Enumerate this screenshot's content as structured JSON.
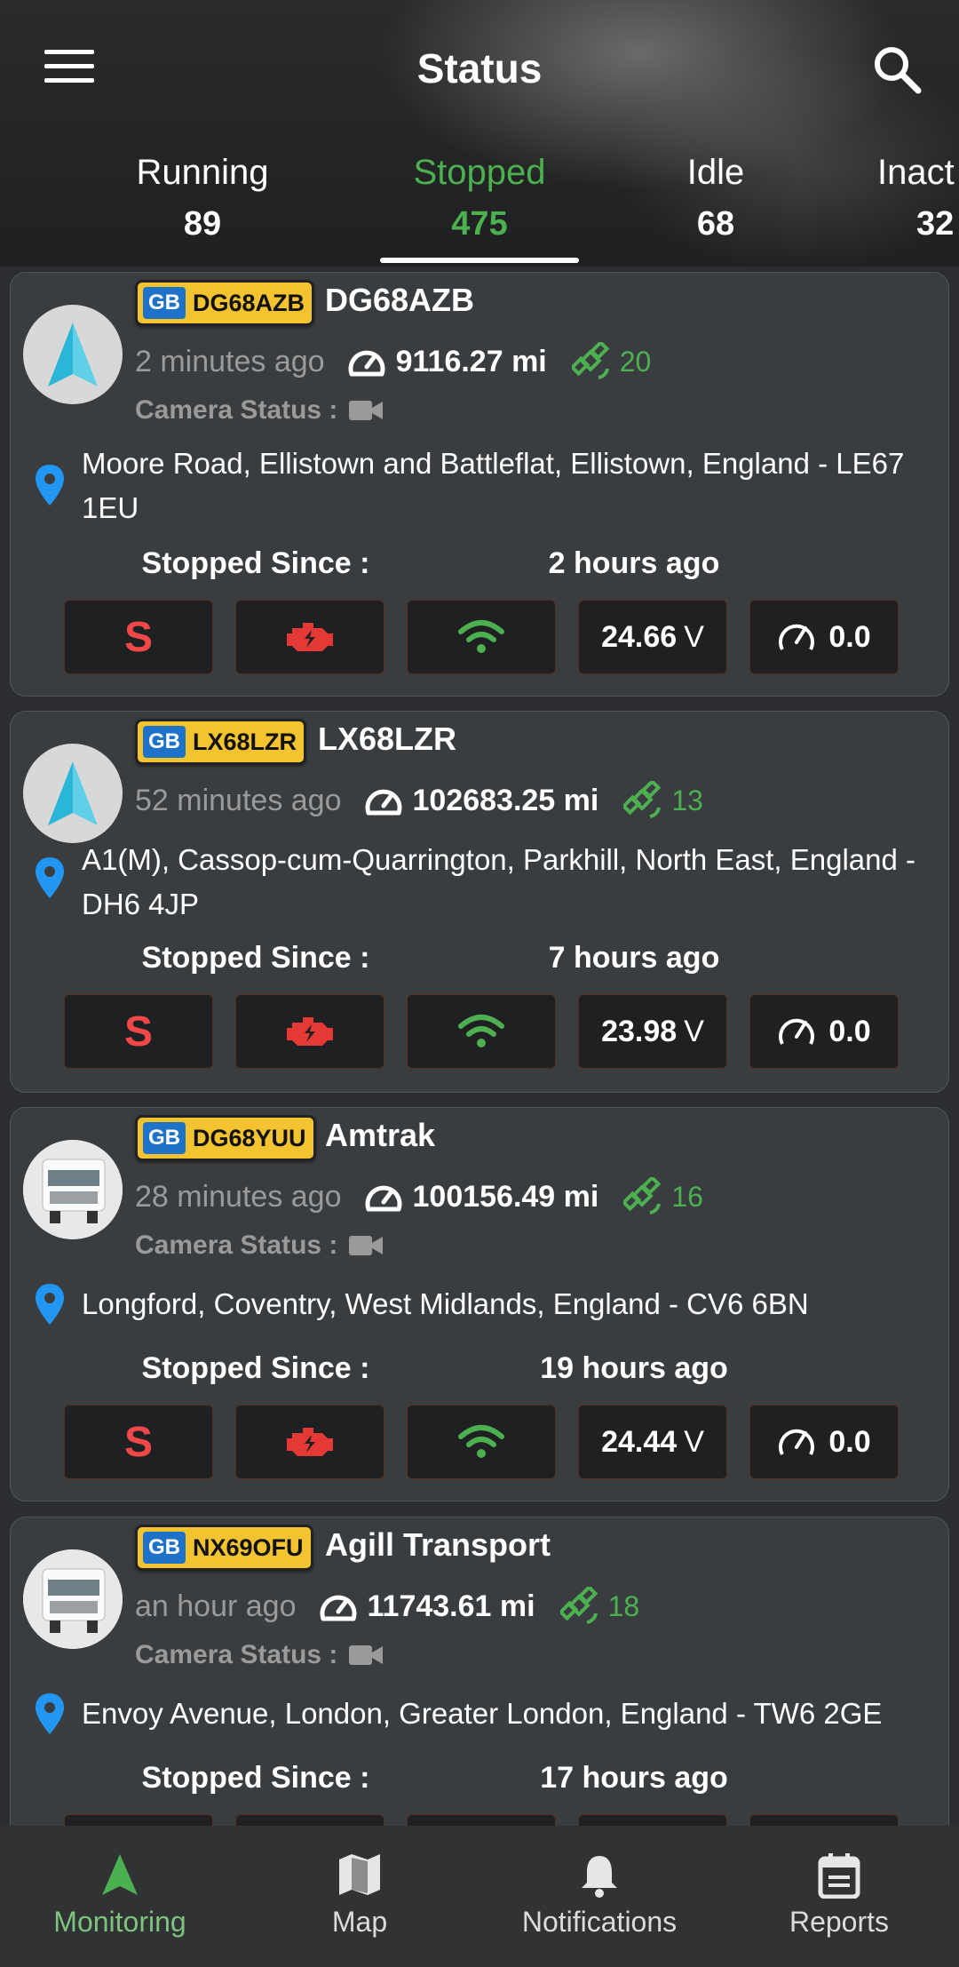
{
  "header": {
    "title": "Status"
  },
  "tabs": [
    {
      "label": "Running",
      "count": "89"
    },
    {
      "label": "Stopped",
      "count": "475"
    },
    {
      "label": "Idle",
      "count": "68"
    },
    {
      "label": "Inact",
      "count": "32"
    }
  ],
  "labels": {
    "camera_status": "Camera Status :",
    "stopped_since": "Stopped Since :",
    "ignition": "S"
  },
  "vehicles": [
    {
      "country": "GB",
      "plate": "DG68AZB",
      "name": "DG68AZB",
      "ago": "2 minutes ago",
      "odometer": "9116.27 mi",
      "satellites": "20",
      "address": "Moore Road, Ellistown and Battleflat, Ellistown, England - LE67 1EU",
      "stopped_since": "2 hours ago",
      "voltage": "24.66",
      "volt_unit": "V",
      "speed": "0.0",
      "avatar": "arrow-icon"
    },
    {
      "country": "GB",
      "plate": "LX68LZR",
      "name": "LX68LZR",
      "ago": "52 minutes ago",
      "odometer": "102683.25 mi",
      "satellites": "13",
      "address": "A1(M), Cassop-cum-Quarrington, Parkhill, North East, England - DH6 4JP",
      "stopped_since": "7 hours ago",
      "voltage": "23.98",
      "volt_unit": "V",
      "speed": "0.0",
      "avatar": "arrow-icon"
    },
    {
      "country": "GB",
      "plate": "DG68YUU",
      "name": "Amtrak",
      "ago": "28 minutes ago",
      "odometer": "100156.49 mi",
      "satellites": "16",
      "address": "Longford, Coventry, West Midlands, England - CV6 6BN",
      "stopped_since": "19 hours ago",
      "voltage": "24.44",
      "volt_unit": "V",
      "speed": "0.0",
      "avatar": "truck-icon"
    },
    {
      "country": "GB",
      "plate": "NX69OFU",
      "name": "Agill Transport",
      "ago": "an hour ago",
      "odometer": "11743.61 mi",
      "satellites": "18",
      "address": "Envoy Avenue, London, Greater London, England - TW6 2GE",
      "stopped_since": "17 hours ago",
      "avatar": "truck-icon"
    }
  ],
  "bottom_nav": [
    {
      "label": "Monitoring",
      "icon": "navigation-arrow-icon"
    },
    {
      "label": "Map",
      "icon": "map-icon"
    },
    {
      "label": "Notifications",
      "icon": "bell-icon"
    },
    {
      "label": "Reports",
      "icon": "calendar-report-icon"
    }
  ],
  "colors": {
    "active_green": "#4caf50",
    "plate_yellow": "#f4c430",
    "pin_blue": "#2196f3",
    "alert_red": "#f04848"
  }
}
